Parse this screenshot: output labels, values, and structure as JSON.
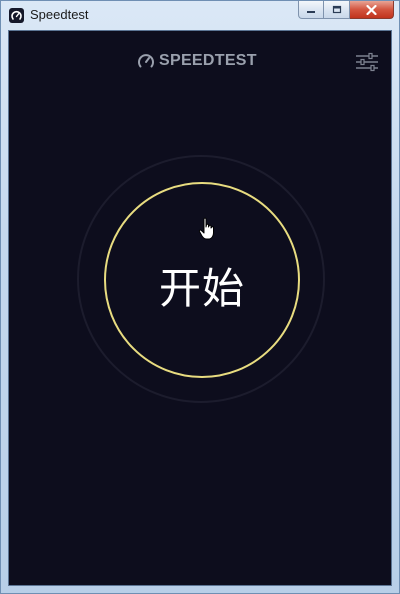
{
  "window": {
    "title": "Speedtest",
    "minimize_icon": "minimize-icon",
    "maximize_icon": "maximize-icon",
    "close_icon": "close-icon"
  },
  "app": {
    "logo_text": "SPEEDTEST",
    "logo_icon": "speedometer-icon",
    "settings_icon": "sliders-icon",
    "start_label": "开始",
    "colors": {
      "background": "#0d0d1d",
      "accent": "#e8dc80",
      "logo": "#9aa0ad",
      "ring": "#1c1c2d"
    }
  }
}
